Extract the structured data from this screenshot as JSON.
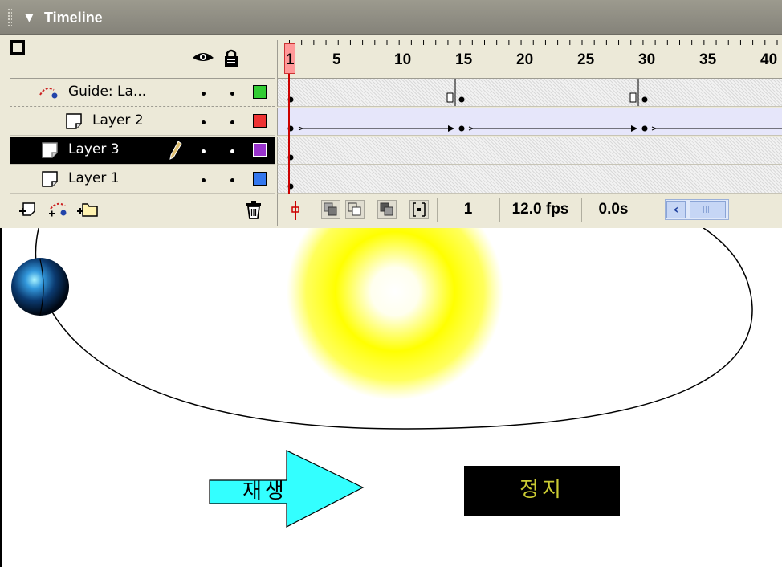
{
  "panel": {
    "title": "Timeline"
  },
  "ruler": {
    "labels": [
      "1",
      "5",
      "10",
      "15",
      "20",
      "25",
      "30",
      "35",
      "40"
    ]
  },
  "layers": [
    {
      "name": "Guide: La...",
      "color": "#33cc33",
      "kind": "guide"
    },
    {
      "name": "Layer 2",
      "color": "#ee3333",
      "kind": "normal"
    },
    {
      "name": "Layer 3",
      "color": "#9933cc",
      "kind": "normal",
      "selected": true
    },
    {
      "name": "Layer 1",
      "color": "#3377ee",
      "kind": "normal"
    }
  ],
  "status": {
    "current_frame": "1",
    "frame_rate": "12.0 fps",
    "elapsed": "0.0s"
  },
  "stage": {
    "play_button_label": "재생",
    "stop_button_label": "정지",
    "play_color": "#33ffff",
    "stop_color": "#000000",
    "stop_text_color": "#cccc33",
    "sun_color": "#ffff00"
  }
}
